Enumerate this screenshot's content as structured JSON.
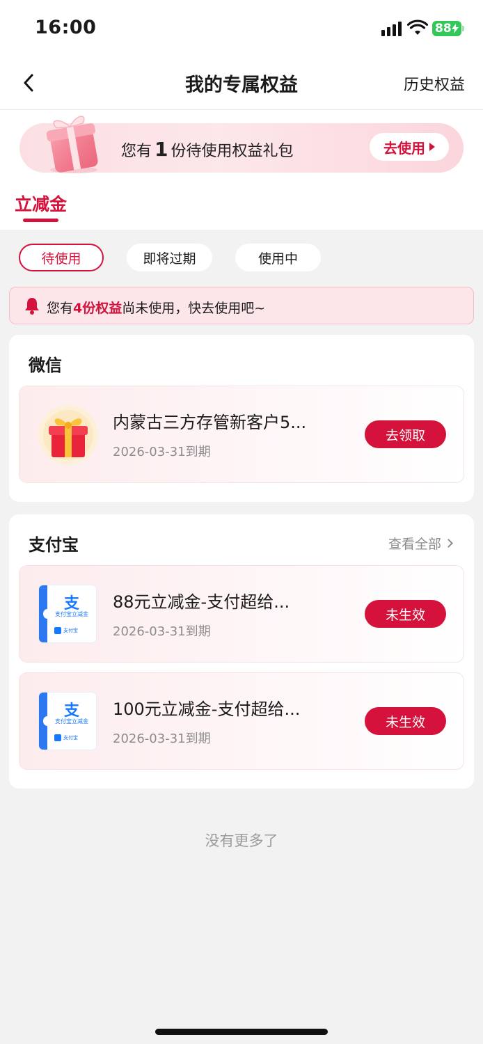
{
  "status_bar": {
    "time": "16:00",
    "battery": "88"
  },
  "nav": {
    "title": "我的专属权益",
    "history_label": "历史权益"
  },
  "banner": {
    "prefix": "您有",
    "count": "1",
    "suffix": "份待使用权益礼包",
    "button_label": "去使用"
  },
  "tab": {
    "label": "立减金"
  },
  "filters": [
    {
      "label": "待使用"
    },
    {
      "label": "即将过期"
    },
    {
      "label": "使用中"
    }
  ],
  "notice": {
    "prefix": "您有",
    "highlight": "4份权益",
    "suffix": "尚未使用，快去使用吧~"
  },
  "groups": [
    {
      "title": "微信",
      "items": [
        {
          "name": "内蒙古三方存管新客户5...",
          "date": "2026-03-31到期",
          "button": "去领取",
          "icon": "gift-icon"
        }
      ]
    },
    {
      "title": "支付宝",
      "view_all": "查看全部",
      "items": [
        {
          "name": "88元立减金-支付超给...",
          "date": "2026-03-31到期",
          "button": "未生效",
          "icon": "alipay-coupon-icon"
        },
        {
          "name": "100元立减金-支付超给...",
          "date": "2026-03-31到期",
          "button": "未生效",
          "icon": "alipay-coupon-icon"
        }
      ]
    }
  ],
  "ticket": {
    "glyph": "支",
    "label": "支付宝立减金",
    "foot": "支付宝"
  },
  "footer": {
    "no_more": "没有更多了"
  },
  "colors": {
    "accent": "#d4123b",
    "page_bg": "#f2f2f2"
  }
}
